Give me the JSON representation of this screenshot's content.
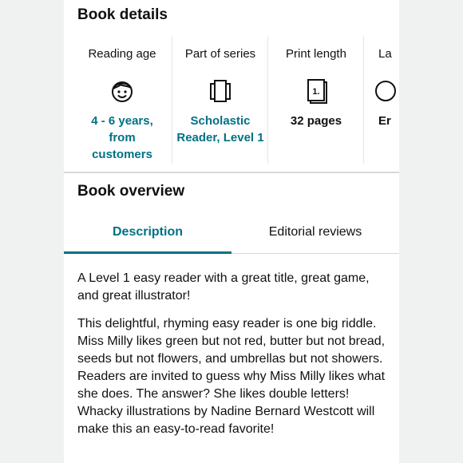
{
  "book_details": {
    "title": "Book details",
    "cards": [
      {
        "label": "Reading age",
        "icon": "child-face-icon",
        "value": "4 - 6 years, from customers"
      },
      {
        "label": "Part of series",
        "icon": "book-series-icon",
        "value": "Scholastic Reader, Level 1"
      },
      {
        "label": "Print length",
        "icon": "page-count-icon",
        "icon_text": "1.",
        "value": "32 pages"
      },
      {
        "label": "La",
        "icon": "language-icon",
        "value": "Er"
      }
    ]
  },
  "book_overview": {
    "title": "Book overview",
    "tabs": [
      {
        "label": "Description",
        "active": true
      },
      {
        "label": "Editorial reviews",
        "active": false
      }
    ],
    "description": [
      "A Level 1 easy reader with a great title, great game, and great illustrator!",
      "This delightful, rhyming easy reader is one big riddle. Miss Milly likes green but not red, butter but not bread, seeds but not flowers, and umbrellas but not showers. Readers are invited to guess why Miss Milly likes what she does. The answer? She likes double letters! Whacky illustrations by Nadine Bernard Westcott will make this an easy-to-read favorite!"
    ]
  },
  "colors": {
    "link": "#007185",
    "text": "#0f1111",
    "background": "#f0f2f2"
  }
}
